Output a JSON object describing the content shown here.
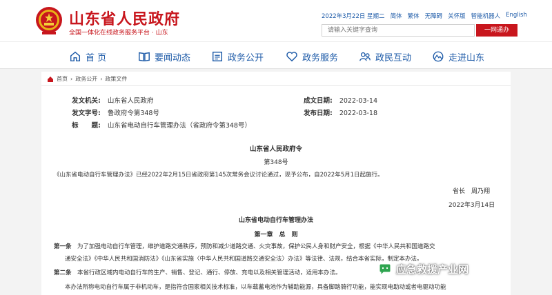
{
  "header": {
    "site_title": "山东省人民政府",
    "site_subtitle": "全国一体化在线政务服务平台 · 山东",
    "top_links": [
      "2022年3月22日 星期二",
      "简体",
      "繁体",
      "无障碍",
      "关怀版",
      "智能机器人",
      "English"
    ],
    "search_placeholder": "请输入关键字查询",
    "search_button": "一网通办"
  },
  "nav": [
    {
      "label": "首 页",
      "icon": "home-icon"
    },
    {
      "label": "要闻动态",
      "icon": "book-icon"
    },
    {
      "label": "政务公开",
      "icon": "document-icon"
    },
    {
      "label": "政务服务",
      "icon": "heart-icon"
    },
    {
      "label": "政民互动",
      "icon": "people-icon"
    },
    {
      "label": "走进山东",
      "icon": "mountain-icon"
    }
  ],
  "breadcrumb": [
    "首页",
    "政务公开",
    "政策文件"
  ],
  "meta": {
    "issuer_label": "发文机关:",
    "issuer": "山东省人民政府",
    "number_label": "发文字号:",
    "number": "鲁政府令第348号",
    "subject_label": "标　　题:",
    "subject": "山东省电动自行车管理办法（省政府令第348号）",
    "date_made_label": "成文日期:",
    "date_made": "2022-03-14",
    "date_pub_label": "发布日期:",
    "date_pub": "2022-03-18"
  },
  "doc": {
    "order_title": "山东省人民政府令",
    "order_number": "第348号",
    "intro": "《山东省电动自行车管理办法》已经2022年2月15日省政府第145次常务会议讨论通过，现予公布，自2022年5月1日起施行。",
    "signer": "省长　周乃翔",
    "sign_date": "2022年3月14日",
    "rule_title": "山东省电动自行车管理办法",
    "chapter": "第一章　总　则",
    "art1_label": "第一条",
    "art1_line1": "为了加强电动自行车管理，维护道路交通秩序，预防和减少道路交通、火灾事故，保护公民人身和财产安全，根据《中华人民共和国道路交",
    "art1_line2": "通安全法》《中华人民共和国消防法》《山东省实施〈中华人民共和国道路交通安全法〉办法》等法律、法规，结合本省实际，制定本办法。",
    "art2_label": "第二条",
    "art2_line1": "本省行政区域内电动自行车的生产、销售、登记、通行、停放、充电以及相关管理活动，适用本办法。",
    "art2_line2": "本办法所称电动自行车属于非机动车，是指符合国家相关技术标准，以车载蓄电池作为辅助能源，具备脚踏骑行功能，能实现电助动或者电驱动功能"
  },
  "watermark": "应急救援产业网",
  "colors": {
    "brand_red": "#c8161d",
    "nav_blue": "#1e5ba8"
  }
}
